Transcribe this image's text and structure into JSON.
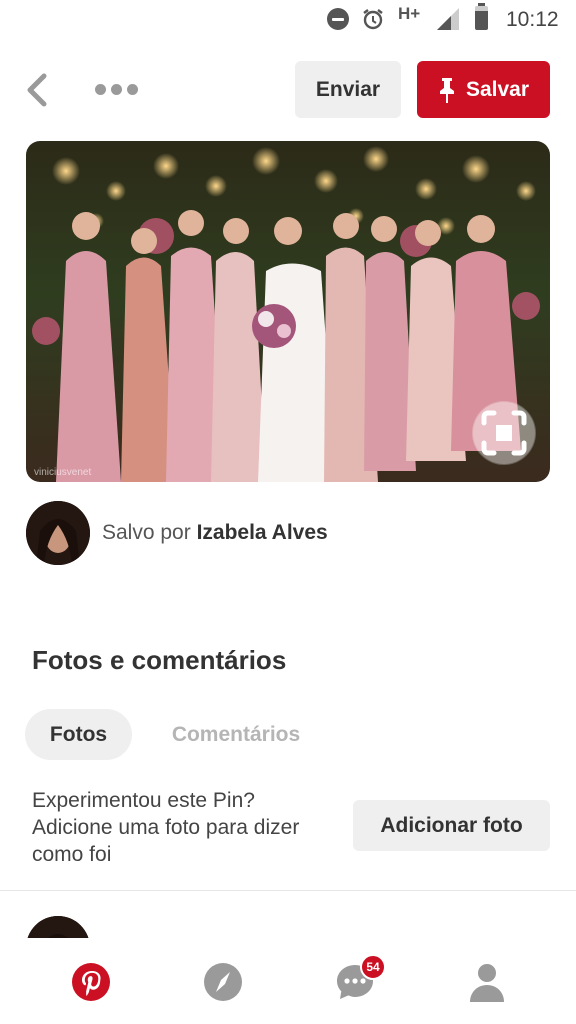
{
  "status_bar": {
    "network": "H+",
    "time": "10:12"
  },
  "header": {
    "send_label": "Enviar",
    "save_label": "Salvar",
    "accent_color": "#cb1023"
  },
  "pin": {
    "image_watermark": "viniciusvenet"
  },
  "saved_by": {
    "prefix": "Salvo por",
    "name": "Izabela Alves"
  },
  "section": {
    "title": "Fotos e comentários",
    "tabs": [
      {
        "label": "Fotos",
        "active": true
      },
      {
        "label": "Comentários",
        "active": false
      }
    ]
  },
  "try_pin": {
    "lines": [
      "Experimentou este Pin?",
      "Adicione uma foto para dizer",
      "como foi"
    ],
    "button_label": "Adicionar foto"
  },
  "bottom_nav": {
    "items": [
      {
        "icon": "pinterest-logo-icon"
      },
      {
        "icon": "compass-icon"
      },
      {
        "icon": "chat-bubble-icon"
      },
      {
        "icon": "person-icon"
      }
    ],
    "messages_badge": "54"
  }
}
